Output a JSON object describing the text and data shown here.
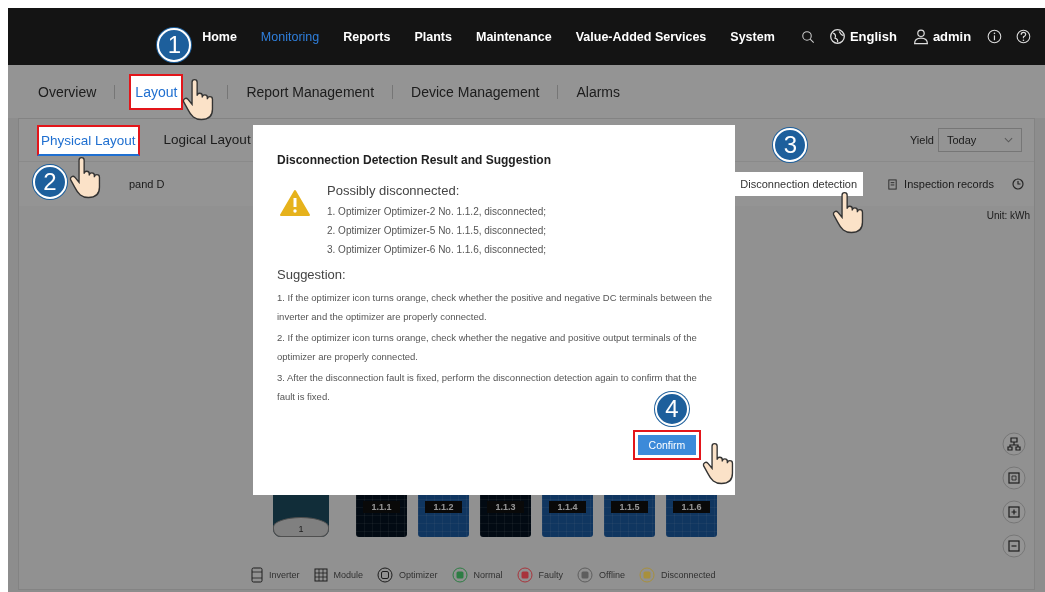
{
  "nav": {
    "items": [
      {
        "label": "Home",
        "selected": false
      },
      {
        "label": "Monitoring",
        "selected": true
      },
      {
        "label": "Reports",
        "selected": false
      },
      {
        "label": "Plants",
        "selected": false
      },
      {
        "label": "Maintenance",
        "selected": false
      },
      {
        "label": "Value-Added Services",
        "selected": false
      },
      {
        "label": "System",
        "selected": false
      }
    ],
    "language": "English",
    "user": "admin"
  },
  "subtabs": [
    {
      "label": "Overview",
      "selected": false,
      "highlighted": false
    },
    {
      "label": "Layout",
      "selected": true,
      "highlighted": true,
      "step": "1"
    },
    {
      "label": "Report Management",
      "selected": false,
      "highlighted": false
    },
    {
      "label": "Device Management",
      "selected": false,
      "highlighted": false
    },
    {
      "label": "Alarms",
      "selected": false,
      "highlighted": false
    }
  ],
  "layout_tabs": [
    {
      "label": "Physical Layout",
      "selected": true,
      "highlighted": true,
      "step": "2"
    },
    {
      "label": "Logical Layout",
      "selected": false,
      "highlighted": false
    }
  ],
  "yield": {
    "label": "Yield",
    "value": "Today"
  },
  "toolbar": {
    "expand_label": "pand D",
    "detection_button": {
      "label": "Disconnection detection",
      "highlighted": true,
      "step": "3"
    },
    "records_button": "Inspection records"
  },
  "unit": "Unit: kWh",
  "inverter": {
    "label": "1"
  },
  "modules": [
    {
      "label": "1.1.1",
      "kind": "dark"
    },
    {
      "label": "1.1.2",
      "kind": "blue"
    },
    {
      "label": "1.1.3",
      "kind": "dark"
    },
    {
      "label": "1.1.4",
      "kind": "blue"
    },
    {
      "label": "1.1.5",
      "kind": "blue"
    },
    {
      "label": "1.1.6",
      "kind": "blue"
    }
  ],
  "legend": [
    {
      "label": "Inverter",
      "kind": "inverter"
    },
    {
      "label": "Module",
      "kind": "module"
    },
    {
      "label": "Optimizer",
      "kind": "optimizer"
    },
    {
      "label": "Normal",
      "kind": "status",
      "color": "#2e7d44"
    },
    {
      "label": "Faulty",
      "kind": "status",
      "color": "#a8343c"
    },
    {
      "label": "Offline",
      "kind": "status",
      "color": "#5e5e5e"
    },
    {
      "label": "Disconnected",
      "kind": "status",
      "color": "#a8903c"
    }
  ],
  "dialog": {
    "title": "Disconnection Detection Result and Suggestion",
    "result_heading": "Possibly disconnected:",
    "results": [
      "1. Optimizer Optimizer-2 No. 1.1.2, disconnected;",
      "2. Optimizer Optimizer-5 No. 1.1.5, disconnected;",
      "3. Optimizer Optimizer-6 No. 1.1.6, disconnected;"
    ],
    "suggestion_heading": "Suggestion:",
    "suggestions": [
      "1. If the optimizer icon turns orange, check whether the positive and negative DC terminals between the inverter and the optimizer are properly connected.",
      "2. If the optimizer icon turns orange, check whether the negative and positive output terminals of the optimizer are properly connected.",
      "3. After the disconnection fault is fixed, perform the disconnection detection again to confirm that the fault is fixed."
    ],
    "confirm": {
      "label": "Confirm",
      "highlighted": true,
      "step": "4"
    }
  }
}
